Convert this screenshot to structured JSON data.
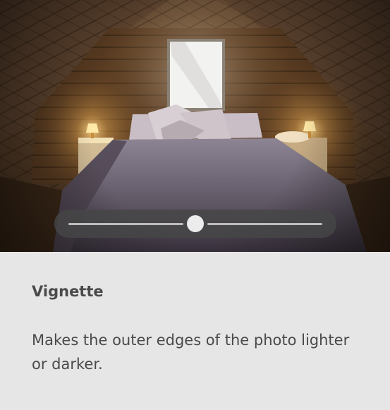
{
  "feature": {
    "title": "Vignette",
    "description": "Makes the outer edges of the photo lighter or darker."
  },
  "slider": {
    "value_fraction": 0.5
  },
  "colors": {
    "panel_bg": "#e6e6e6",
    "text": "#4a4a4a",
    "slider_bg": "#464646",
    "slider_track": "#bdbdbd",
    "slider_thumb": "#ececec"
  },
  "photo": {
    "subject": "attic-bedroom"
  }
}
